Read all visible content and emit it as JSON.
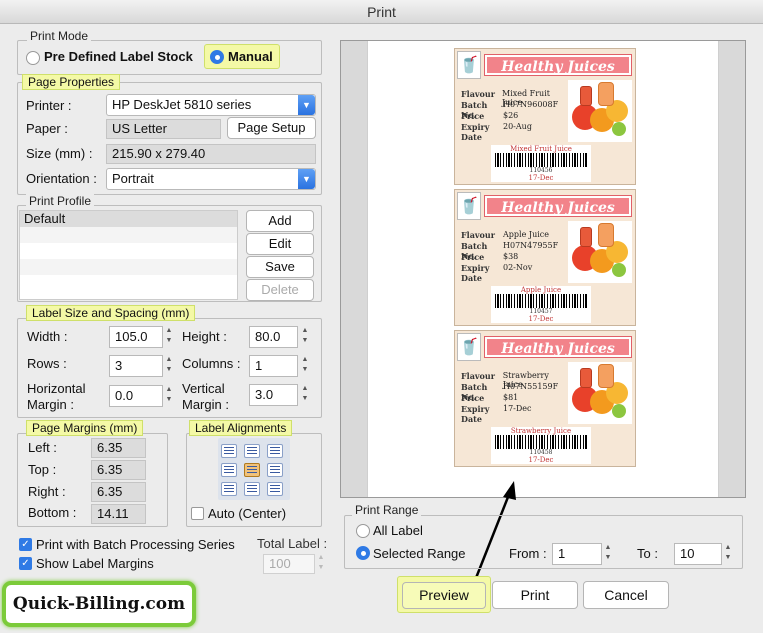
{
  "window": {
    "title": "Print"
  },
  "print_mode": {
    "legend": "Print Mode",
    "option_predefined": "Pre Defined Label Stock",
    "option_manual": "Manual",
    "selected": "Manual"
  },
  "page_properties": {
    "legend": "Page Properties",
    "printer_label": "Printer :",
    "printer_value": "HP DeskJet 5810 series",
    "paper_label": "Paper :",
    "paper_value": "US Letter",
    "page_setup_button": "Page Setup",
    "size_label": "Size (mm) :",
    "size_value": "215.90 x 279.40",
    "orientation_label": "Orientation :",
    "orientation_value": "Portrait"
  },
  "print_profile": {
    "legend": "Print Profile",
    "items": [
      "Default"
    ],
    "add_button": "Add",
    "edit_button": "Edit",
    "save_button": "Save",
    "delete_button": "Delete"
  },
  "label_size": {
    "legend": "Label Size and Spacing (mm)",
    "width_label": "Width :",
    "width_value": "105.0",
    "height_label": "Height :",
    "height_value": "80.0",
    "rows_label": "Rows :",
    "rows_value": "3",
    "columns_label": "Columns :",
    "columns_value": "1",
    "hmargin_label_1": "Horizontal",
    "hmargin_label_2": "Margin :",
    "hmargin_value": "0.0",
    "vmargin_label_1": "Vertical",
    "vmargin_label_2": "Margin :",
    "vmargin_value": "3.0"
  },
  "page_margins": {
    "legend": "Page Margins (mm)",
    "left_label": "Left :",
    "left_value": "6.35",
    "top_label": "Top :",
    "top_value": "6.35",
    "right_label": "Right :",
    "right_value": "6.35",
    "bottom_label": "Bottom :",
    "bottom_value": "14.11"
  },
  "label_alignments": {
    "legend": "Label Alignments",
    "selected": "middle-center",
    "auto_center_label": "Auto (Center)",
    "auto_center_checked": false
  },
  "options": {
    "batch_label": "Print with Batch Processing Series",
    "batch_checked": true,
    "margins_label": "Show Label Margins",
    "margins_checked": true,
    "total_label": "Total Label :",
    "total_value": "100"
  },
  "preview_labels": [
    {
      "title": "Healthy Juices",
      "flavour_key": "Flavour",
      "flavour": "Mixed Fruit Juice",
      "batch_key": "Batch No.",
      "batch": "H07N96008F",
      "price_key": "Price",
      "price": "$26",
      "expiry_key": "Expiry Date",
      "expiry": "20-Aug",
      "barcode_name": "Mixed Fruit Juice",
      "barcode_number": "110456",
      "barcode_date": "17-Dec"
    },
    {
      "title": "Healthy Juices",
      "flavour_key": "Flavour",
      "flavour": "Apple Juice",
      "batch_key": "Batch No.",
      "batch": "H07N47955F",
      "price_key": "Price",
      "price": "$38",
      "expiry_key": "Expiry Date",
      "expiry": "02-Nov",
      "barcode_name": "Apple Juice",
      "barcode_number": "110457",
      "barcode_date": "17-Dec"
    },
    {
      "title": "Healthy Juices",
      "flavour_key": "Flavour",
      "flavour": "Strawberry Juice",
      "batch_key": "Batch No.",
      "batch": "H07N55159F",
      "price_key": "Price",
      "price": "$81",
      "expiry_key": "Expiry Date",
      "expiry": "17-Dec",
      "barcode_name": "Strawberry Juice",
      "barcode_number": "110458",
      "barcode_date": "17-Dec"
    }
  ],
  "print_range": {
    "legend": "Print Range",
    "all_label": "All Label",
    "selected_label": "Selected Range",
    "selected": "Selected Range",
    "from_label": "From :",
    "from_value": "1",
    "to_label": "To :",
    "to_value": "10"
  },
  "actions": {
    "preview": "Preview",
    "print": "Print",
    "cancel": "Cancel"
  },
  "brand": {
    "text": "Quick-Billing.com"
  },
  "colors": {
    "accent": "#2f7ae5",
    "highlight": "#f4f9a6",
    "label_title": "#f2838a",
    "label_bg": "#f6e7d6"
  }
}
